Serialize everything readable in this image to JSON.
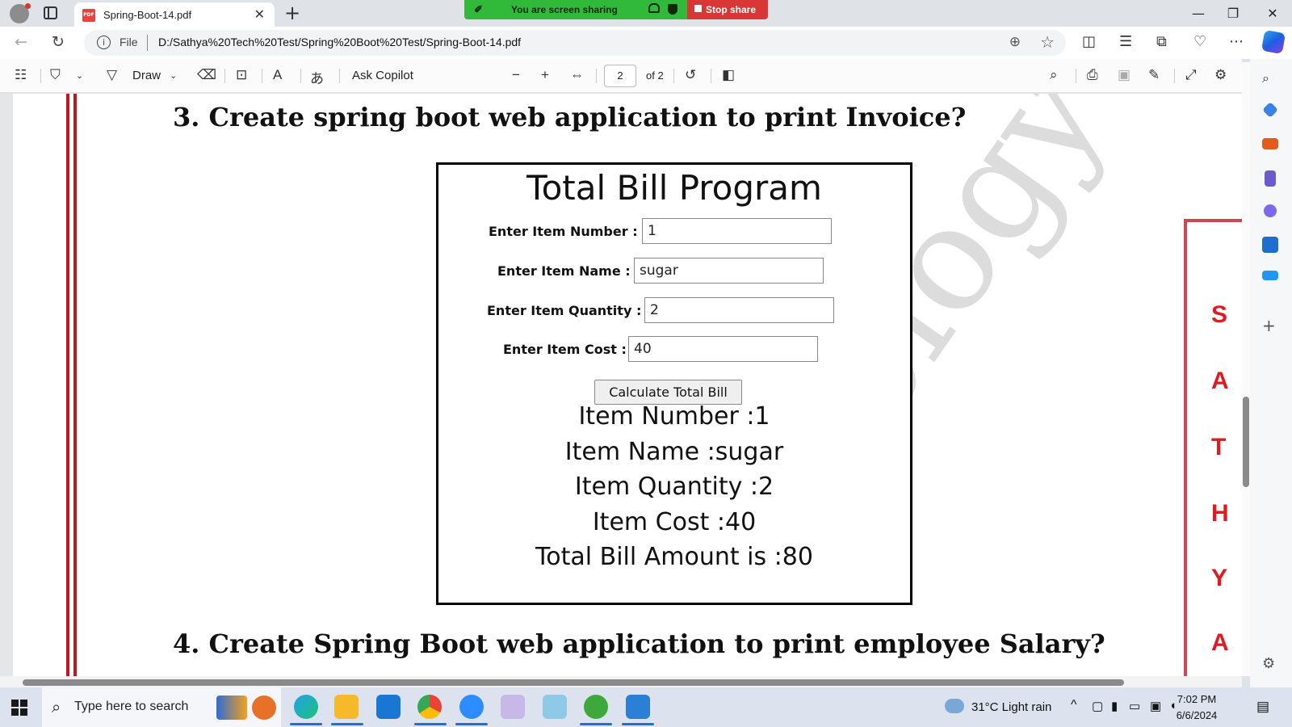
{
  "browser": {
    "tab_title": "Spring-Boot-14.pdf",
    "url_scheme": "File",
    "url": "D:/Sathya%20Tech%20Test/Spring%20Boot%20Test/Spring-Boot-14.pdf",
    "screen_share_text": "You are screen sharing",
    "stop_share_label": "Stop share"
  },
  "pdf_toolbar": {
    "draw_label": "Draw",
    "ask_copilot_label": "Ask Copilot",
    "current_page": "2",
    "page_count": "of 2"
  },
  "document": {
    "heading3": "3. Create spring boot web application to print Invoice?",
    "heading4": "4. Create Spring Boot web application to print employee Salary?",
    "watermark": "ology",
    "form": {
      "title": "Total Bill Program",
      "fields": [
        {
          "label": "Enter Item Number :",
          "value": "1"
        },
        {
          "label": "Enter Item Name :",
          "value": "sugar"
        },
        {
          "label": "Enter Item Quantity :",
          "value": "2"
        },
        {
          "label": "Enter Item Cost :",
          "value": "40"
        }
      ],
      "button": "Calculate Total Bill",
      "results": [
        "Item Number :1",
        "Item Name :sugar",
        "Item Quantity :2",
        "Item Cost :40",
        "Total Bill Amount is :80"
      ]
    },
    "side_letters": [
      "S",
      "A",
      "T",
      "H",
      "Y",
      "A"
    ]
  },
  "taskbar": {
    "search_placeholder": "Type here to search",
    "weather": "31°C  Light rain",
    "time": "7:02 PM",
    "date": "6/6/2024"
  }
}
